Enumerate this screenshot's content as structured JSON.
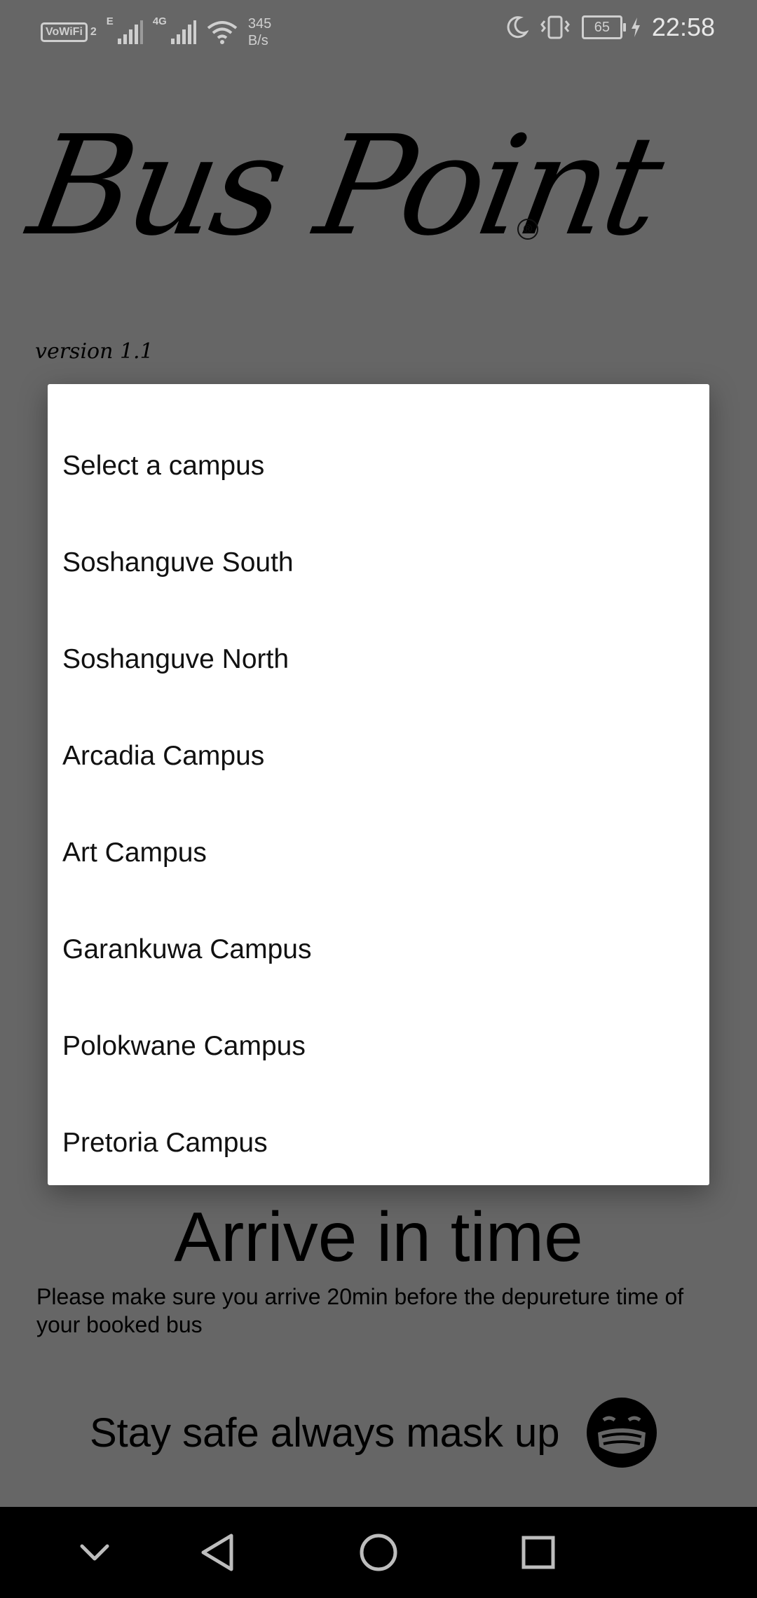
{
  "status_bar": {
    "vowifi": "VoWiFi",
    "sim_index": "2",
    "network_e": "E",
    "network_4g": "4G",
    "speed_value": "345",
    "speed_unit": "B/s",
    "battery": "65",
    "time": "22:58",
    "icons": [
      "wifi-icon",
      "signal-icon",
      "moon-icon",
      "vibrate-icon",
      "battery-icon",
      "charging-icon"
    ]
  },
  "app": {
    "logo_text": "Bus Point",
    "registered_mark": "®",
    "version": "version 1.1"
  },
  "campus_picker": {
    "items": [
      "Select a campus",
      "Soshanguve South",
      "Soshanguve North",
      "Arcadia Campus",
      "Art Campus",
      "Garankuwa Campus",
      "Polokwane Campus",
      "Pretoria Campus"
    ]
  },
  "content": {
    "heading": "Arrive in time",
    "note": "Please make sure you arrive 20min before the depureture time of your booked bus",
    "safety": "Stay safe always mask up",
    "safety_icon": "mask-face-icon"
  },
  "nav_bar": {
    "icons": [
      "chevron-down-icon",
      "back-triangle-icon",
      "home-circle-icon",
      "recents-square-icon"
    ]
  }
}
